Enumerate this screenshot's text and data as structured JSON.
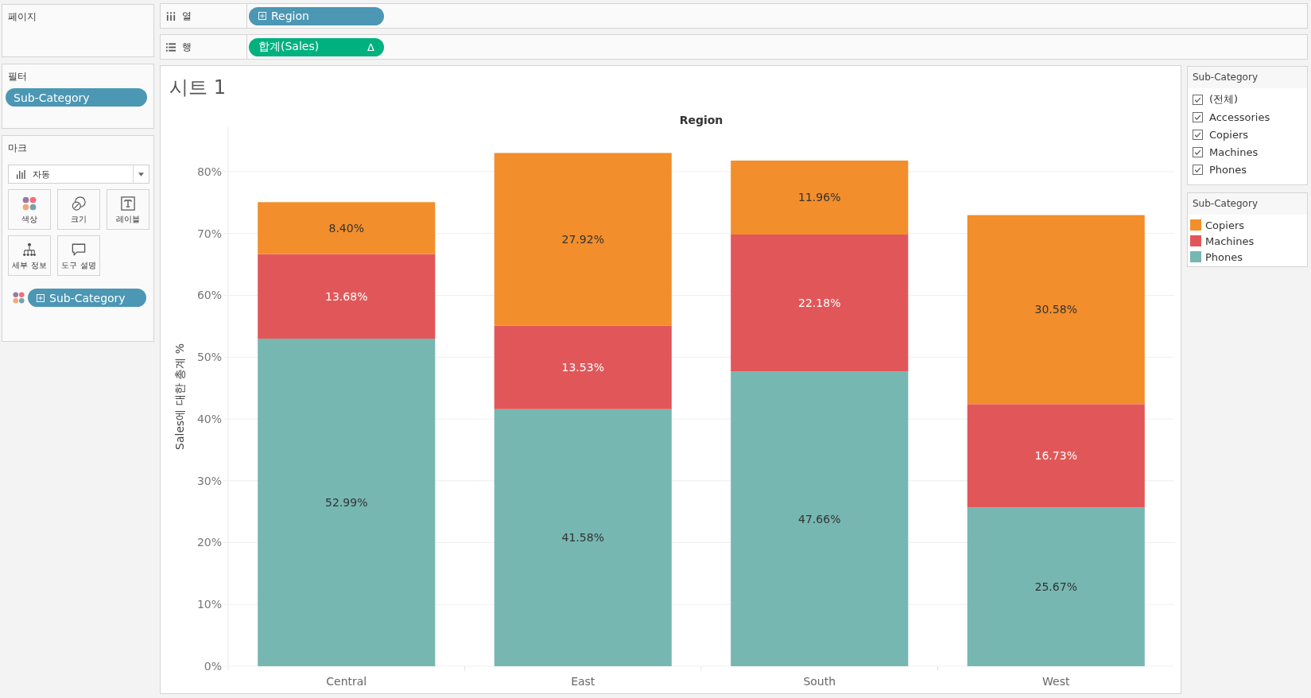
{
  "left_panel": {
    "pages": {
      "title": "페이지"
    },
    "filters": {
      "title": "필터",
      "pills": [
        {
          "label": "Sub-Category",
          "kind": "dimension",
          "expandable": false
        }
      ]
    },
    "marks": {
      "title": "마크",
      "mark_type": "자동",
      "buttons": [
        {
          "label": "색상",
          "kind": "color"
        },
        {
          "label": "크기",
          "kind": "size"
        },
        {
          "label": "레이블",
          "kind": "label"
        },
        {
          "label": "세부 정보",
          "kind": "detail"
        },
        {
          "label": "도구 설명",
          "kind": "tooltip"
        }
      ],
      "fields": [
        {
          "kind": "color",
          "pill": {
            "label": "Sub-Category",
            "kind": "dimension",
            "expandable": true
          }
        }
      ]
    }
  },
  "shelves": [
    {
      "kind": "columns",
      "label": "열",
      "pills": [
        {
          "label": "Region",
          "kind": "dimension",
          "expandable": true
        }
      ]
    },
    {
      "kind": "rows",
      "label": "행",
      "pills": [
        {
          "label": "합계(Sales)",
          "kind": "measure",
          "expandable": false,
          "calc_mark": "Δ"
        }
      ]
    }
  ],
  "sheet": {
    "title": "시트 1",
    "chart_data": {
      "type": "bar",
      "stacked": true,
      "grid": true,
      "title": "Region",
      "ylabel": "Sales에 대한 총계 %",
      "categories": [
        "Central",
        "East",
        "South",
        "West"
      ],
      "series": [
        {
          "name": "Copiers",
          "color": "#f28e2b",
          "values": [
            8.4,
            27.92,
            11.96,
            30.58
          ],
          "value_labels": [
            "8.40%",
            "27.92%",
            "11.96%",
            "30.58%"
          ]
        },
        {
          "name": "Machines",
          "color": "#e15759",
          "values": [
            13.68,
            13.53,
            22.18,
            16.73
          ],
          "value_labels": [
            "13.68%",
            "13.53%",
            "22.18%",
            "16.73%"
          ]
        },
        {
          "name": "Phones",
          "color": "#76b7b2",
          "values": [
            52.99,
            41.58,
            47.66,
            25.67
          ],
          "value_labels": [
            "52.99%",
            "41.58%",
            "47.66%",
            "25.67%"
          ]
        }
      ],
      "ylim": [
        0,
        87.2
      ],
      "yticks": [
        {
          "value": 0,
          "label": "0%"
        },
        {
          "value": 10,
          "label": "10%"
        },
        {
          "value": 20,
          "label": "20%"
        },
        {
          "value": 30,
          "label": "30%"
        },
        {
          "value": 40,
          "label": "40%"
        },
        {
          "value": 50,
          "label": "50%"
        },
        {
          "value": 60,
          "label": "60%"
        },
        {
          "value": 70,
          "label": "70%"
        },
        {
          "value": 80,
          "label": "80%"
        }
      ],
      "data_labels": true
    }
  },
  "legends": [
    {
      "kind": "filter",
      "title": "Sub-Category",
      "items": [
        {
          "label": "(전체)",
          "checked": true
        },
        {
          "label": "Accessories",
          "checked": true
        },
        {
          "label": "Copiers",
          "checked": true
        },
        {
          "label": "Machines",
          "checked": true
        },
        {
          "label": "Phones",
          "checked": true
        }
      ]
    },
    {
      "kind": "color",
      "title": "Sub-Category"
    }
  ]
}
